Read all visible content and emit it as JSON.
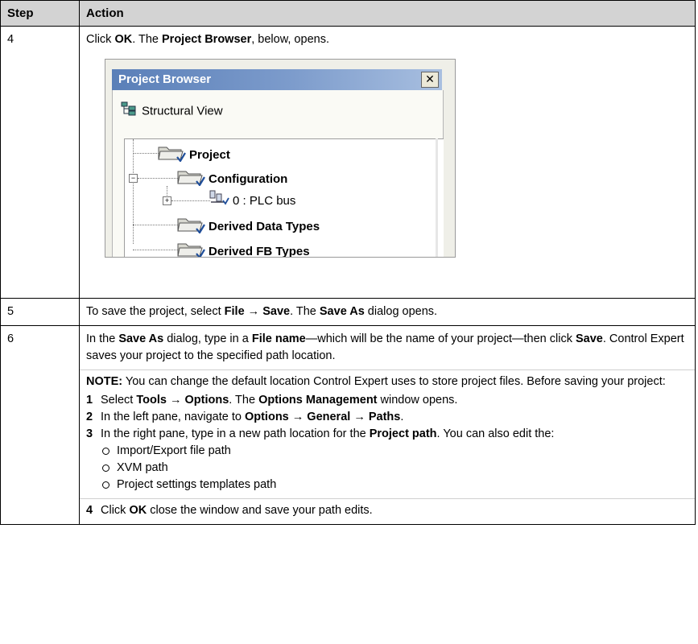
{
  "headers": {
    "step": "Step",
    "action": "Action"
  },
  "row4": {
    "step": "4",
    "t1": "Click ",
    "b1": "OK",
    "t2": ". The ",
    "b2": "Project Browser",
    "t3": ", below, opens."
  },
  "project_browser": {
    "title": "Project Browser",
    "close_glyph": "✕",
    "view_label": "Structural View",
    "tree": [
      {
        "label": "Project"
      },
      {
        "label": "Configuration"
      },
      {
        "label": "0 : PLC bus"
      },
      {
        "label": "Derived Data Types"
      },
      {
        "label": "Derived FB Types"
      }
    ],
    "expander_minus": "−",
    "expander_plus": "+"
  },
  "row5": {
    "step": "5",
    "t1": "To save the project, select ",
    "b1": "File → Save",
    "t2": ". The ",
    "b2": "Save As",
    "t3": " dialog opens."
  },
  "row6": {
    "step": "6",
    "p1_t1": "In the ",
    "p1_b1": "Save As",
    "p1_t2": " dialog, type in a ",
    "p1_b2": "File name",
    "p1_t3": "—which will be the name of your project—then click ",
    "p1_b3": "Save",
    "p1_t4": ". Control Expert saves your project to the specified path location.",
    "note_label": "NOTE:",
    "note_text": " You can change the default location Control Expert uses to store project files. Before saving your project:",
    "steps": [
      {
        "num": "1",
        "t1": "Select ",
        "b1": "Tools → Options",
        "t2": ". The ",
        "b2": "Options Management",
        "t3": " window opens."
      },
      {
        "num": "2",
        "t1": "In the left pane, navigate to ",
        "b1": "Options → General → Paths",
        "t2": "."
      },
      {
        "num": "3",
        "t1": "In the right pane, type in a new path location for the ",
        "b1": "Project path",
        "t2": ". You can also edit the:"
      },
      {
        "num": "4",
        "t1": "Click ",
        "b1": "OK",
        "t2": " close the window and save your path edits."
      }
    ],
    "bullets": [
      "Import/Export file path",
      "XVM path",
      "Project settings templates path"
    ]
  }
}
